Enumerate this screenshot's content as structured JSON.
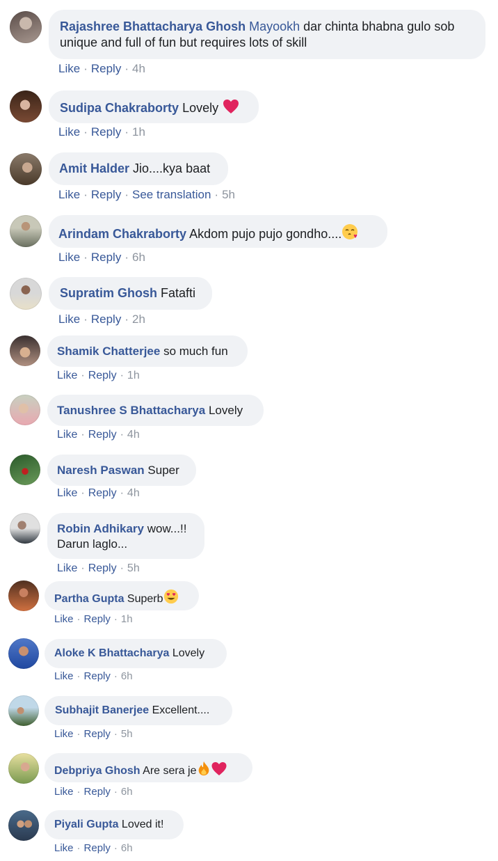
{
  "comments": [
    {
      "name": "Rajashree Bhattacharya Ghosh",
      "mention": "Mayookh",
      "text": " dar chinta bhabna gulo sob unique and full of fun but requires lots of skill",
      "time": "4h"
    },
    {
      "name": "Sudipa Chakraborty",
      "text": "Lovely",
      "emoji": "heart",
      "time": "1h"
    },
    {
      "name": "Amit Halder",
      "text": "Jio....kya baat",
      "translation": "See translation",
      "time": "5h"
    },
    {
      "name": "Arindam Chakraborty",
      "text": "Akdom pujo pujo gondho....",
      "emoji": "blowing-kiss-face",
      "time": "6h"
    },
    {
      "name": "Supratim Ghosh",
      "text": "Fatafti",
      "time": "2h"
    },
    {
      "name": "Shamik Chatterjee",
      "text": "so much fun",
      "time": "1h"
    },
    {
      "name": "Tanushree S Bhattacharya",
      "text": "Lovely",
      "time": "4h"
    },
    {
      "name": "Naresh Paswan",
      "text": "Super",
      "time": "4h"
    },
    {
      "name": "Robin Adhikary",
      "text": "wow...!!",
      "text2": "Darun laglo...",
      "time": "5h"
    },
    {
      "name": "Partha Gupta",
      "text": "Superb",
      "emoji": "heart-eyes-face",
      "time": "1h"
    },
    {
      "name": "Aloke K Bhattacharya",
      "text": "Lovely",
      "time": "6h"
    },
    {
      "name": "Subhajit Banerjee",
      "text": "Excellent....",
      "time": "5h"
    },
    {
      "name": "Debpriya Ghosh",
      "text": "Are sera je",
      "emoji": "fire",
      "emoji2": "heart",
      "time": "6h"
    },
    {
      "name": "Piyali Gupta",
      "text": "Loved it!",
      "time": "6h"
    }
  ],
  "actions": {
    "like": "Like",
    "reply": "Reply",
    "separator": "·"
  },
  "colors": {
    "bubble": "#f0f2f5",
    "name": "#385898",
    "meta": "#8d949e",
    "text": "#1c1e21"
  }
}
